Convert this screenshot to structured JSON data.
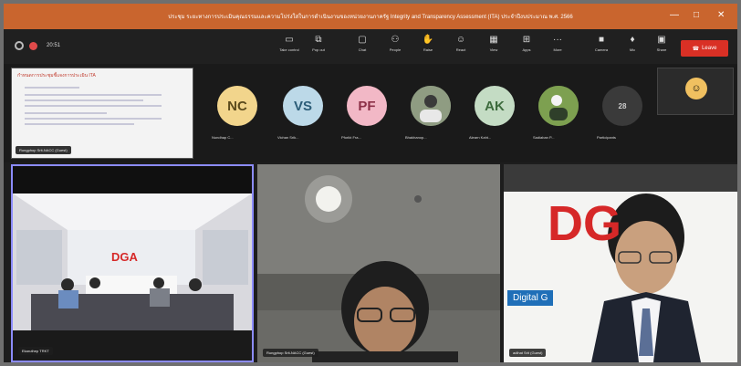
{
  "window": {
    "title": "ประชุม ระยะทางการประเมินคุณธรรมและความโปร่งใสในการดำเนินงานของหน่วยงานภาครัฐ Integrity and Transparency Assessment (ITA) ประจำปีงบประมาณ พ.ศ. 2566",
    "controls": {
      "minimize": "—",
      "restore": "□",
      "close": "✕"
    }
  },
  "toolbar": {
    "timer": "20:51",
    "buttons": [
      {
        "label": "Take control",
        "icon": "screen-icon"
      },
      {
        "label": "Pop out",
        "icon": "popout-icon"
      },
      {
        "label": "Chat",
        "icon": "chat-icon"
      },
      {
        "label": "People",
        "icon": "people-icon"
      },
      {
        "label": "Raise",
        "icon": "hand-icon"
      },
      {
        "label": "React",
        "icon": "smile-icon"
      },
      {
        "label": "View",
        "icon": "grid-icon"
      },
      {
        "label": "Apps",
        "icon": "apps-icon"
      },
      {
        "label": "More",
        "icon": "more-icon"
      },
      {
        "label": "Camera",
        "icon": "camera-icon"
      },
      {
        "label": "Mic",
        "icon": "mic-icon"
      },
      {
        "label": "Share",
        "icon": "share-icon"
      }
    ],
    "leave_label": "Leave"
  },
  "shared_screen": {
    "doc_title": "กำหนดการประชุมชี้แจงการประเมิน ITA",
    "presenter": "Rungphop Srit-NACC (Guest)"
  },
  "participants": [
    {
      "initials": "NC",
      "name": "Nundhap C...",
      "color": "#f2d58c",
      "text_color": "#5a4a1c"
    },
    {
      "initials": "VS",
      "name": "Vichan Srik...",
      "color": "#bcd9e8",
      "text_color": "#2c5d78"
    },
    {
      "initials": "PF",
      "name": "Pforikt Fra...",
      "color": "#f2b8c6",
      "text_color": "#8c2f47"
    },
    {
      "initials": "",
      "name": "Bhakhanop...",
      "color": "#7a8a6e",
      "text_color": "#fff"
    },
    {
      "initials": "AK",
      "name": "Alearn Kaht...",
      "color": "#c4dcc4",
      "text_color": "#3d6b3d"
    },
    {
      "initials": "",
      "name": "Sadiaban P...",
      "color": "#6f8a4a",
      "text_color": "#fff"
    },
    {
      "initials": "28",
      "name": "Participants",
      "color": "#3a3a3a",
      "text_color": "#ccc"
    }
  ],
  "videos": [
    {
      "label": "Ekaruthep TRKT",
      "logo": "DGA"
    },
    {
      "label": "Rungphop Srit-NACC (Guest)"
    },
    {
      "label": "adihat Srit (Guest)",
      "logo": "DG",
      "banner": "Digital G"
    }
  ],
  "colors": {
    "title_bar": "#c9652e",
    "leave": "#d93025",
    "active_border": "#8c8cff",
    "dga_red": "#d62828"
  }
}
